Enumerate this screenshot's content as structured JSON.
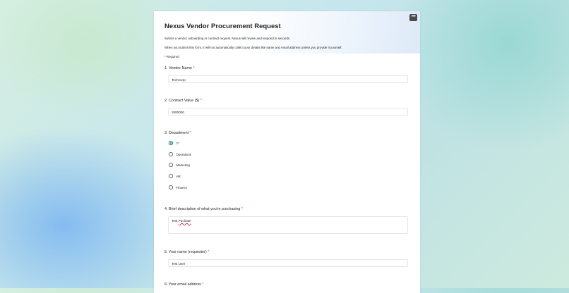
{
  "form": {
    "title": "Nexus Vendor Procurement Request",
    "description": "Submit a vendor onboarding or contract request. Nexus will review and respond in seconds.",
    "privacy_note": "When you submit this form, it will not automatically collect your details like name and email address unless you provide it yourself.",
    "required_note": "* Required",
    "more_label": "•••"
  },
  "questions": {
    "q1": {
      "label": "1. Vendor Name",
      "star": "*",
      "value": "TechCorp"
    },
    "q2": {
      "label": "2. Contract Value ($)",
      "star": "*",
      "value": "2000000"
    },
    "q3": {
      "label": "3. Department",
      "star": "*",
      "options": [
        "IT",
        "Operations",
        "Marketing",
        "HR",
        "Finance"
      ],
      "selected": "IT"
    },
    "q4": {
      "label": "4. Brief description of what you're purchasing",
      "star": "*",
      "value_word1": "Test",
      "value_word2": "Puchase"
    },
    "q5": {
      "label": "5. Your name (requester)",
      "star": "*",
      "value": "Test User"
    },
    "q6": {
      "label": "6. Your email address",
      "star": "*"
    }
  },
  "colors": {
    "accent": "#03787c",
    "required": "#c4314b"
  },
  "icons": {
    "more": "more-options-icon"
  }
}
